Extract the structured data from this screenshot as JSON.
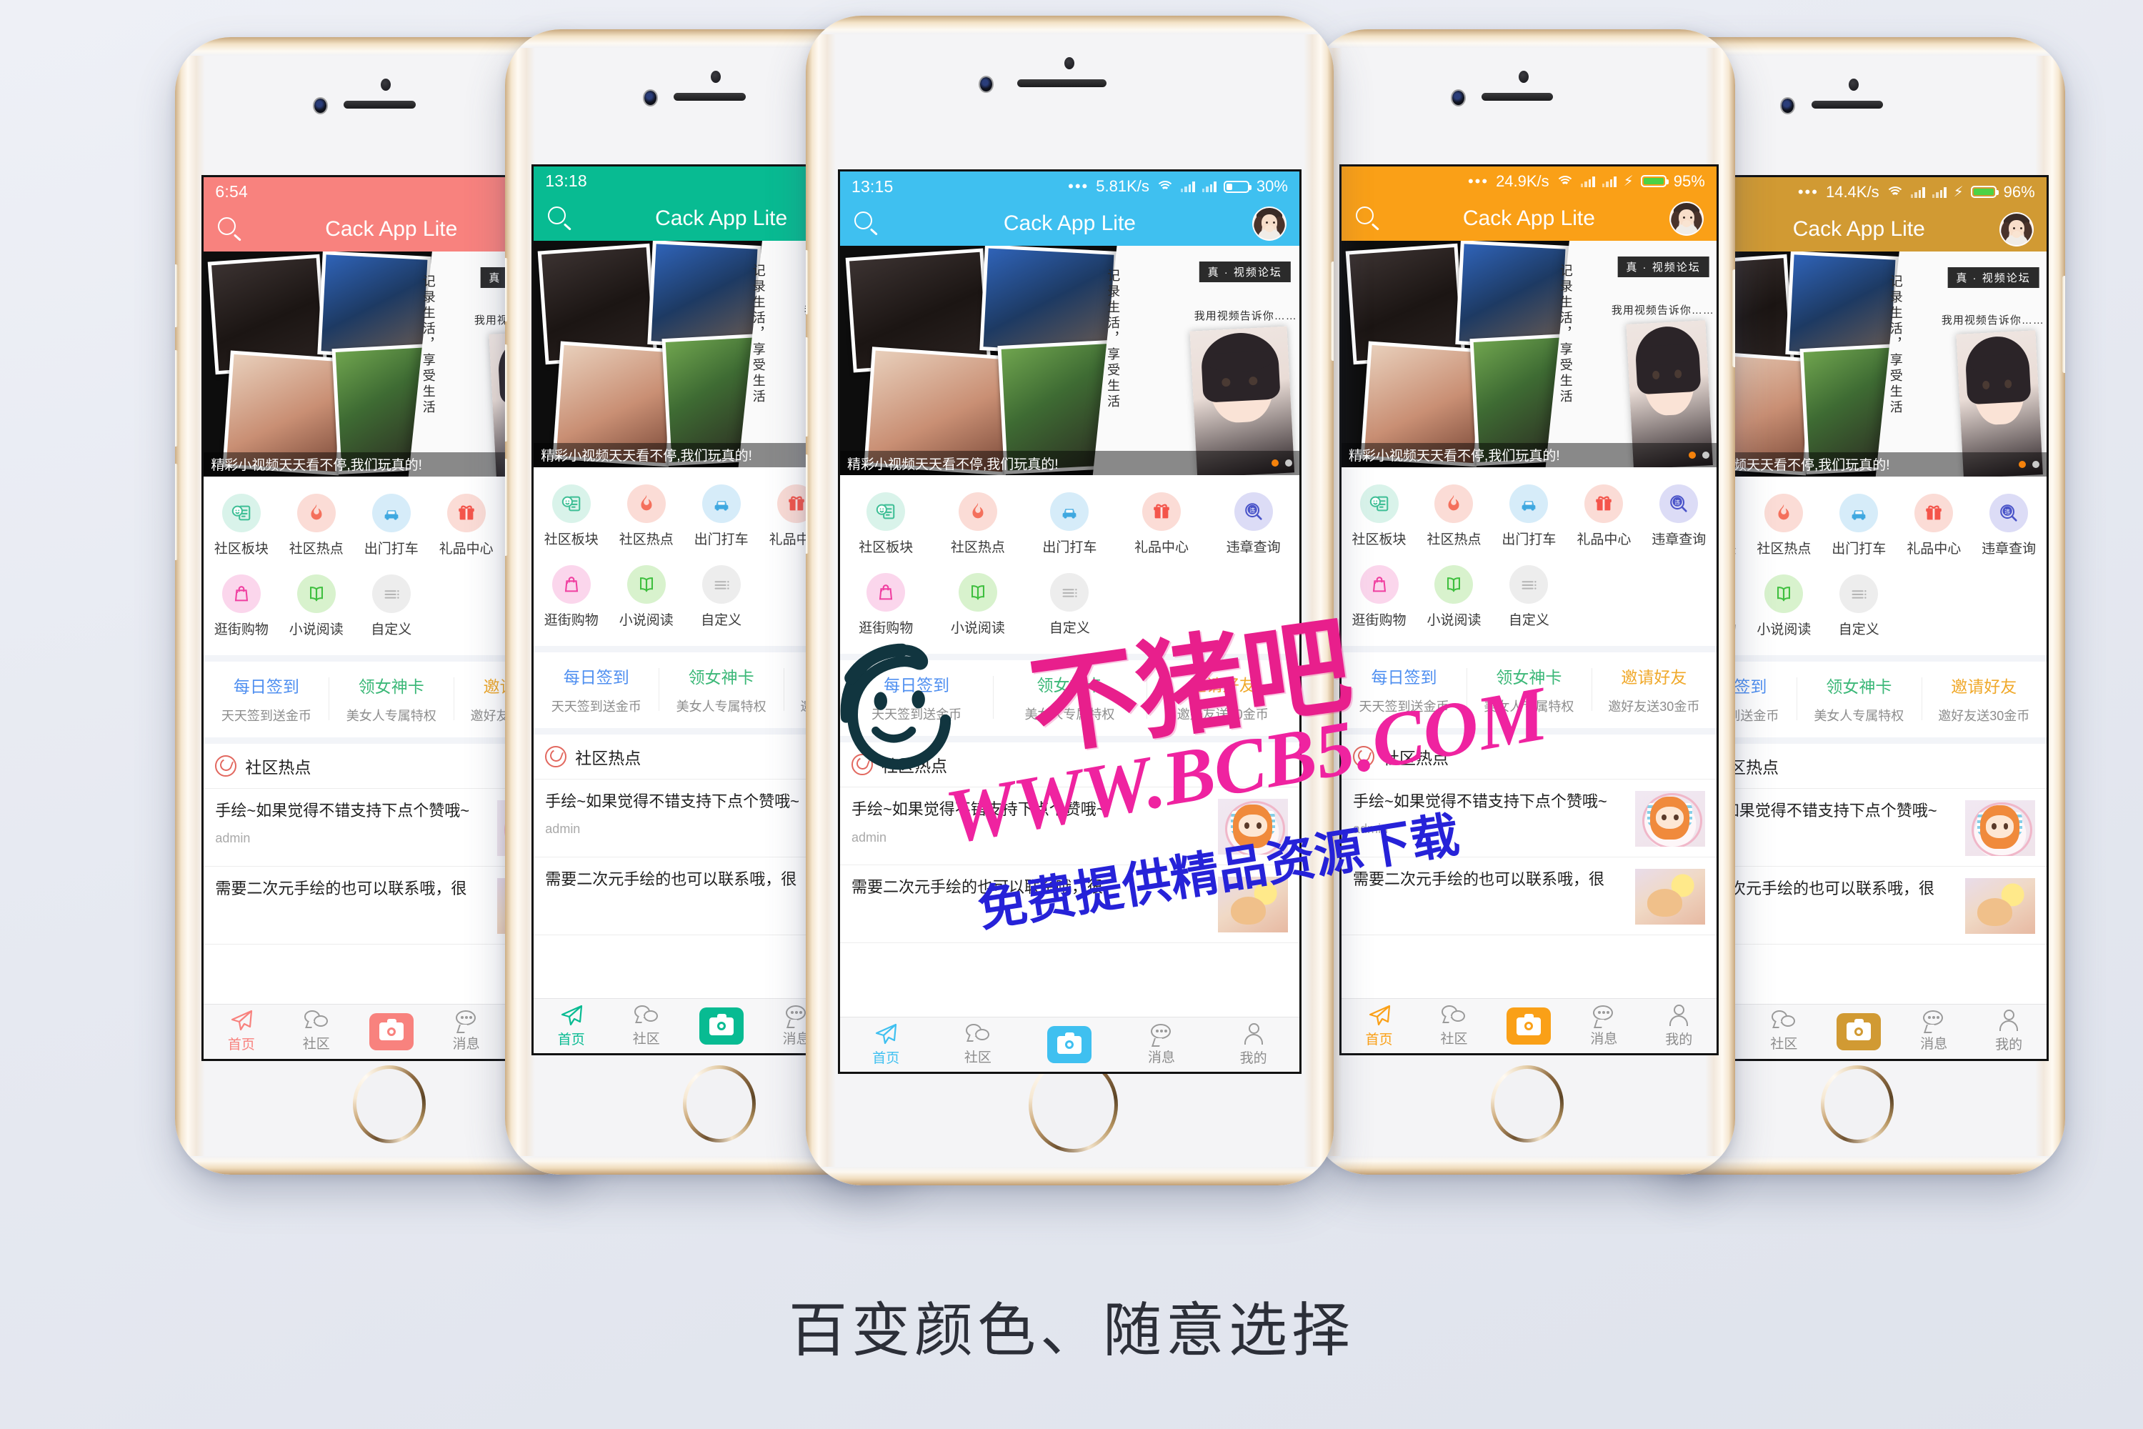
{
  "page": {
    "caption": "百变颜色、随意选择",
    "background_colors": [
      "#eef0f6",
      "#dfe3ec"
    ]
  },
  "watermark": {
    "brand": "不猪吧",
    "site": "WWW.BCB5.COM",
    "tagline": "免费提供精品资源下载",
    "brand_color": "#e81f8c",
    "site_color": "#ef23a0",
    "tagline_color": "#2622d8"
  },
  "app": {
    "title": "Cack App Lite",
    "banner": {
      "caption": "精彩小视频天天看不停,我们玩真的!",
      "tag": "真 · 视频论坛",
      "subtitle": "我用视频告诉你……",
      "vertical": "记录生活，享受生活",
      "dots": 2,
      "active_dot": 0
    },
    "grid": {
      "row1": [
        {
          "label": "社区板块",
          "icon": "community-board-icon",
          "bg": "#d9f3ea",
          "fg": "#3fbf96"
        },
        {
          "label": "社区热点",
          "icon": "flame-icon",
          "bg": "#fbdcd6",
          "fg": "#f4705c"
        },
        {
          "label": "出门打车",
          "icon": "car-icon",
          "bg": "#d6ecf9",
          "fg": "#3fa8e0"
        },
        {
          "label": "礼品中心",
          "icon": "gift-icon",
          "bg": "#fbdcd6",
          "fg": "#f4554b"
        },
        {
          "label": "违章查询",
          "icon": "violation-search-icon",
          "bg": "#dcdcf6",
          "fg": "#4a54c9"
        }
      ],
      "row2": [
        {
          "label": "逛街购物",
          "icon": "shopping-bag-icon",
          "bg": "#fbd6ec",
          "fg": "#f03fa0"
        },
        {
          "label": "小说阅读",
          "icon": "book-icon",
          "bg": "#d8f2cd",
          "fg": "#3fbf3f"
        },
        {
          "label": "自定义",
          "icon": "custom-list-icon",
          "bg": "#ededed",
          "fg": "#b5b5b5"
        }
      ]
    },
    "promos": [
      {
        "title": "每日签到",
        "desc": "天天签到送金币",
        "color": "#4f8ff0"
      },
      {
        "title": "领女神卡",
        "desc": "美女人专属特权",
        "color": "#3cb878"
      },
      {
        "title": "邀请好友",
        "desc": "邀好友送30金币",
        "color": "#f0a92b"
      }
    ],
    "section": {
      "title": "社区热点",
      "icon": "hotspot-icon"
    },
    "posts": [
      {
        "title": "手绘~如果觉得不错支持下点个赞哦~",
        "user": "admin",
        "thumb": "anime-girl"
      },
      {
        "title": "需要二次元手绘的也可以联系哦，很",
        "user": "",
        "thumb": "food"
      }
    ],
    "tabs": [
      {
        "label": "首页",
        "icon": "paper-plane-icon",
        "active": true
      },
      {
        "label": "社区",
        "icon": "community-chat-icon",
        "active": false
      },
      {
        "label": "",
        "icon": "camera-icon",
        "active": false,
        "is_camera": true
      },
      {
        "label": "消息",
        "icon": "message-icon",
        "active": false
      },
      {
        "label": "我的",
        "icon": "profile-icon",
        "active": false
      }
    ]
  },
  "phones": [
    {
      "theme_color": "#f8827e",
      "theme_name": "coral",
      "status": {
        "time": "6:54",
        "dots": "",
        "speed": "",
        "battery_pct": "",
        "charging": false,
        "show_right": false
      }
    },
    {
      "theme_color": "#08bb92",
      "theme_name": "teal",
      "status": {
        "time": "13:18",
        "dots": "",
        "speed": "",
        "battery_pct": "",
        "charging": false,
        "show_right": false
      }
    },
    {
      "theme_color": "#3fc0f0",
      "theme_name": "sky-blue",
      "status": {
        "time": "13:15",
        "dots": "•••",
        "speed": "5.81K/s",
        "battery_pct": "30%",
        "charging": false,
        "show_right": true
      }
    },
    {
      "theme_color": "#faa017",
      "theme_name": "orange",
      "status": {
        "time": "",
        "dots": "•••",
        "speed": "24.9K/s",
        "battery_pct": "95%",
        "charging": true,
        "show_right": true
      }
    },
    {
      "theme_color": "#d19a33",
      "theme_name": "gold",
      "status": {
        "time": "",
        "dots": "•••",
        "speed": "14.4K/s",
        "battery_pct": "96%",
        "charging": true,
        "show_right": true
      }
    }
  ]
}
